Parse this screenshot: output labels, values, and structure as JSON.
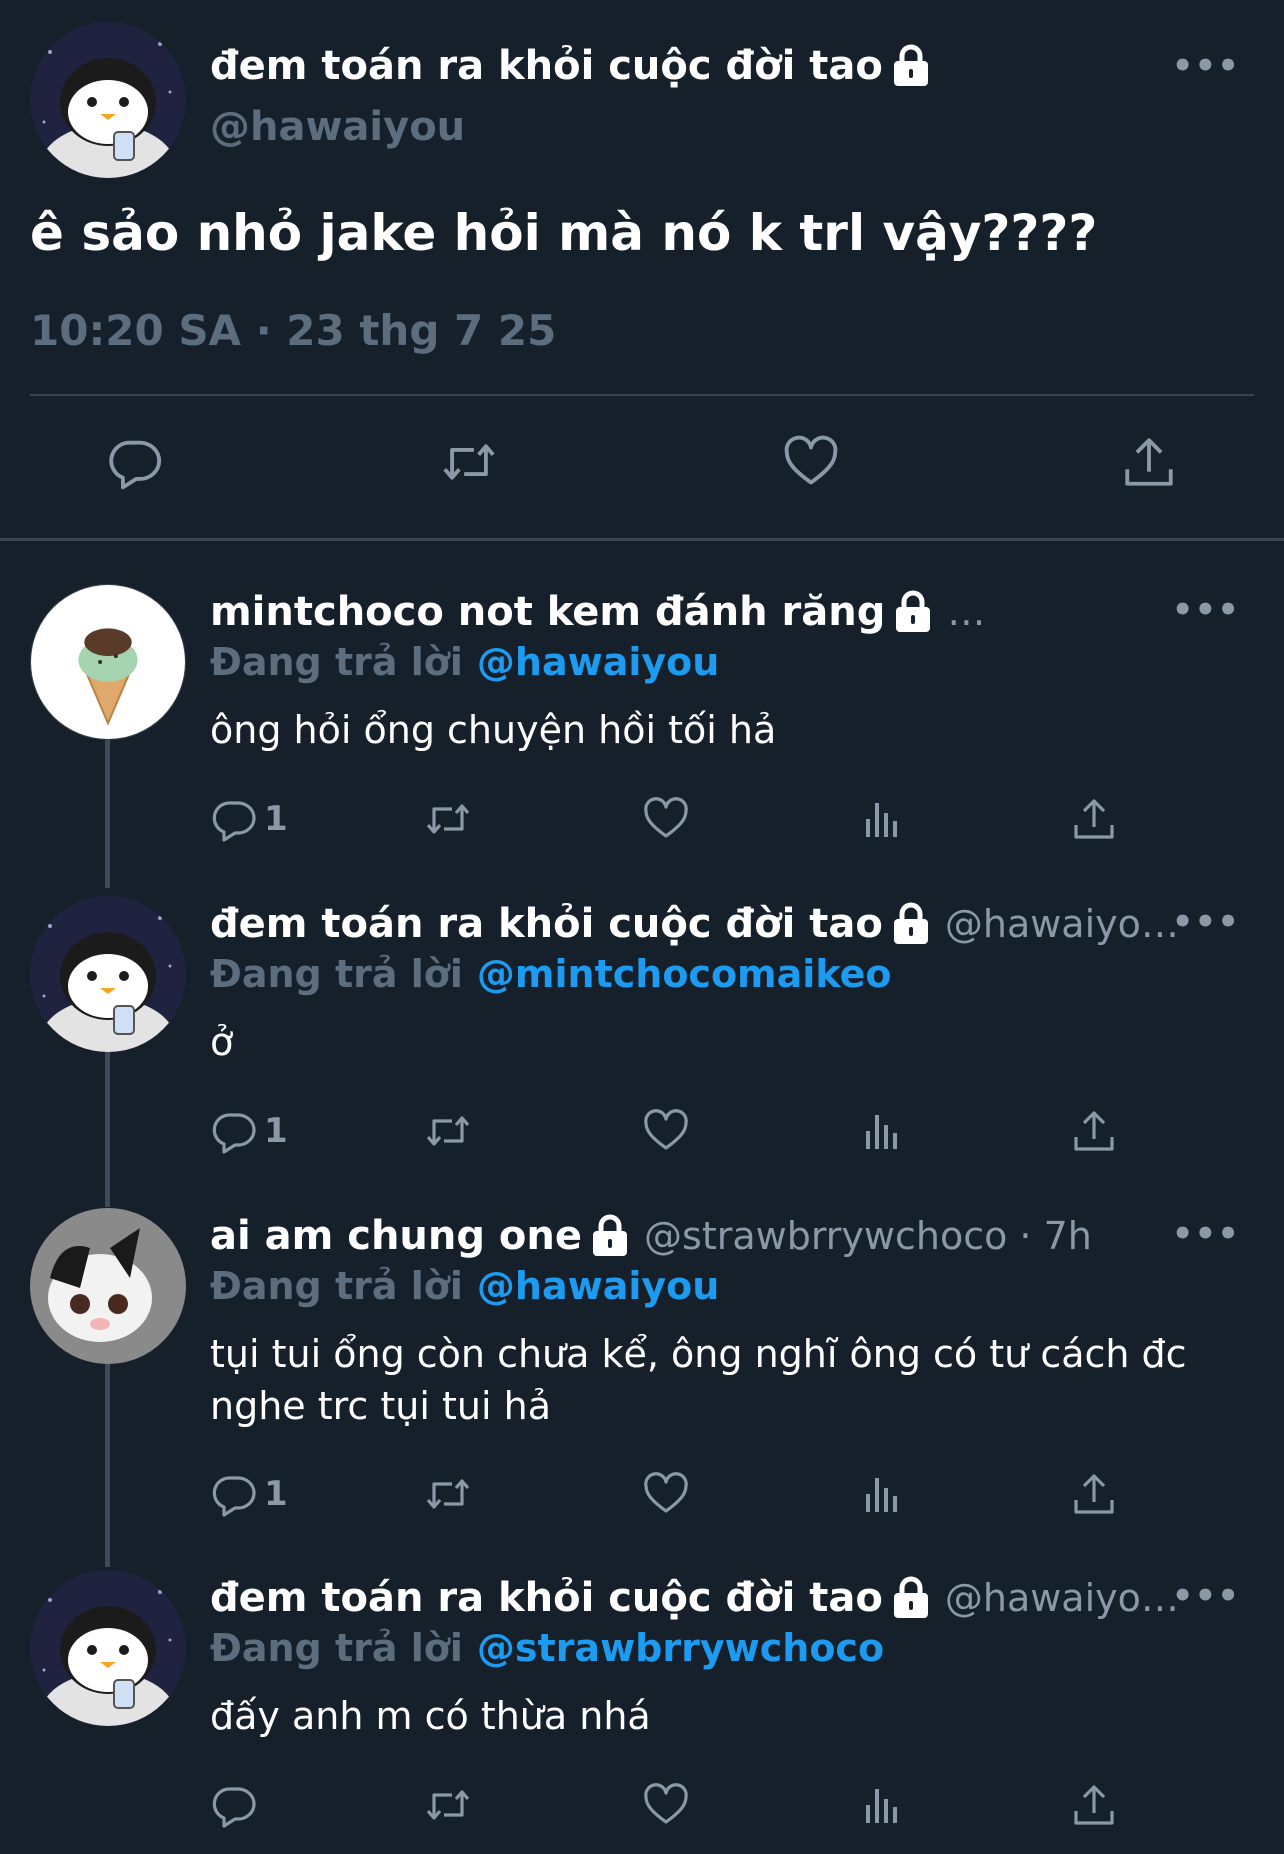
{
  "colors": {
    "background": "#15202b",
    "link": "#1d9bf0",
    "muted": "#8b98a5"
  },
  "main_tweet": {
    "display_name": "đem toán ra khỏi cuộc đời tao",
    "handle": "@hawaiyou",
    "text": "ê sảo nhỏ jake hỏi mà nó k trl vậy????",
    "timestamp": "10:20 SA · 23 thg 7 25",
    "more_label": "•••",
    "actions": [
      "reply-icon",
      "retweet-icon",
      "like-icon",
      "share-icon"
    ]
  },
  "replies": [
    {
      "display_name": "mintchoco not kem đánh răng",
      "handle": "…",
      "reply_prefix": "Đang trả lời",
      "reply_to": "@hawaiyou",
      "text": "ông hỏi ổng chuyện hồi tối hả",
      "reply_count": "1",
      "avatar": "icecream"
    },
    {
      "display_name": "đem toán ra khỏi cuộc đời tao",
      "handle": "@hawaiyo…",
      "reply_prefix": "Đang trả lời",
      "reply_to": "@mintchocomaikeo",
      "text": "ở",
      "reply_count": "1",
      "avatar": "penguin"
    },
    {
      "display_name": "ai am chung one",
      "handle": "@strawbrrywchoco · 7h",
      "reply_prefix": "Đang trả lời",
      "reply_to": "@hawaiyou",
      "text": "tụi tui ổng còn chưa kể, ông nghĩ ông có tư cách đc nghe trc tụi tui hả",
      "reply_count": "1",
      "avatar": "cat"
    },
    {
      "display_name": "đem toán ra khỏi cuộc đời tao",
      "handle": "@hawaiyo…",
      "reply_prefix": "Đang trả lời",
      "reply_to": "@strawbrrywchoco",
      "text": "đấy anh m có thừa nhá",
      "reply_count": "",
      "avatar": "penguin"
    }
  ],
  "more_label": "•••"
}
